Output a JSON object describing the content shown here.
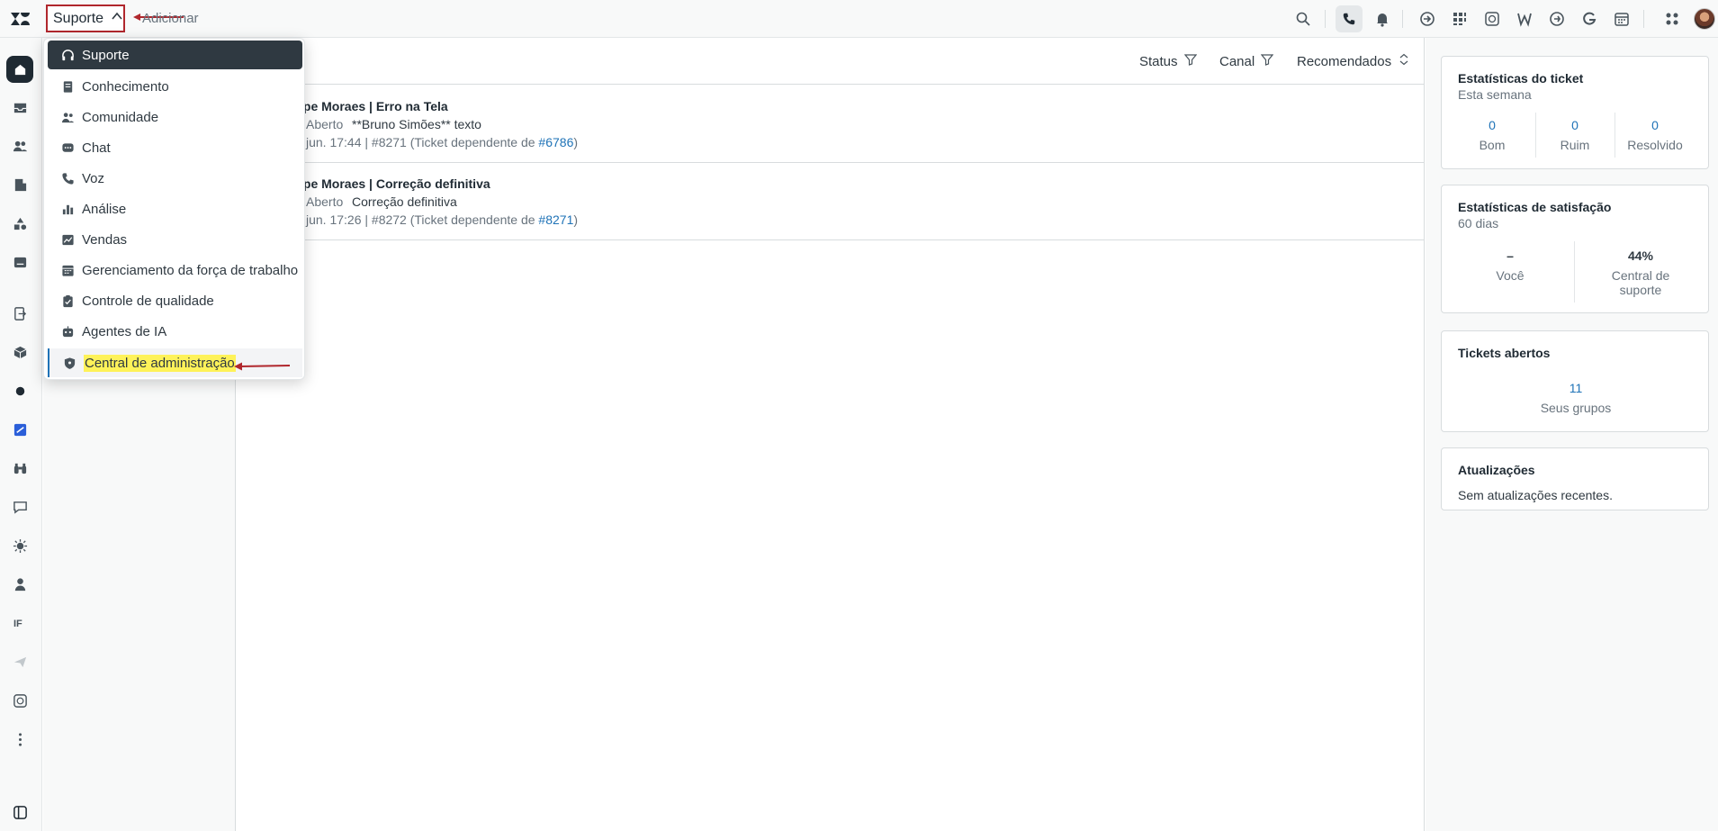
{
  "topbar": {
    "product_label": "Suporte",
    "add_label": "Adicionar"
  },
  "filters": {
    "status": "Status",
    "channel": "Canal",
    "sort": "Recomendados"
  },
  "tickets": [
    {
      "title": "ipe Moraes | Erro na Tela",
      "status": "Aberto",
      "subtitle": "**Bruno Simões** texto",
      "meta_prefix": "jun. 17:44 | #8271 (Ticket dependente de ",
      "meta_link": "#6786",
      "meta_suffix": ")"
    },
    {
      "title": "ipe Moraes | Correção definitiva",
      "status": "Aberto",
      "subtitle": "Correção definitiva",
      "meta_prefix": "jun. 17:26 | #8272 (Ticket dependente de ",
      "meta_link": "#8271",
      "meta_suffix": ")"
    }
  ],
  "menu": {
    "items": [
      {
        "label": "Suporte",
        "icon": "headset-icon"
      },
      {
        "label": "Conhecimento",
        "icon": "book-icon"
      },
      {
        "label": "Comunidade",
        "icon": "people-icon"
      },
      {
        "label": "Chat",
        "icon": "chat-icon"
      },
      {
        "label": "Voz",
        "icon": "phone-icon"
      },
      {
        "label": "Análise",
        "icon": "bar-chart-icon"
      },
      {
        "label": "Vendas",
        "icon": "trend-icon"
      },
      {
        "label": "Gerenciamento da força de trabalho",
        "icon": "calendar-icon"
      },
      {
        "label": "Controle de qualidade",
        "icon": "clipboard-check-icon"
      },
      {
        "label": "Agentes de IA",
        "icon": "robot-icon"
      },
      {
        "label": "Central de administração",
        "icon": "shield-icon"
      }
    ]
  },
  "right": {
    "ticket_stats": {
      "title": "Estatísticas do ticket",
      "subtitle": "Esta semana",
      "good_value": "0",
      "good_label": "Bom",
      "bad_value": "0",
      "bad_label": "Ruim",
      "solved_value": "0",
      "solved_label": "Resolvido"
    },
    "satisfaction": {
      "title": "Estatísticas de satisfação",
      "subtitle": "60 dias",
      "you_value": "–",
      "you_label": "Você",
      "center_value": "44%",
      "center_label": "Central de suporte"
    },
    "open_tickets": {
      "title": "Tickets abertos",
      "value": "11",
      "label": "Seus grupos"
    },
    "updates": {
      "title": "Atualizações",
      "text": "Sem atualizações recentes."
    }
  },
  "nav": {
    "ifl_label": "IF"
  },
  "colors": {
    "accent": "#1f73b7",
    "annotation_red": "#b0272d",
    "highlight": "#fef259",
    "active_menu": "#2f3941"
  }
}
